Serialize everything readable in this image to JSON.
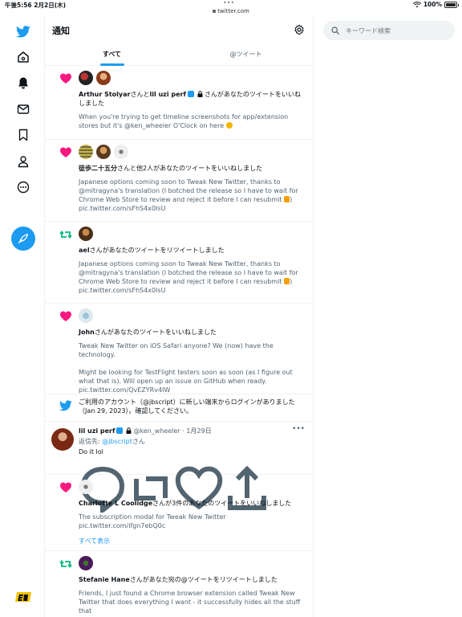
{
  "status": {
    "time": "午後5:56",
    "date": "2月2日(木)",
    "url": "twitter.com",
    "battery": "100%",
    "battery_level": 1.0
  },
  "header": {
    "title": "通知",
    "tabs": [
      "すべて",
      "@ツイート"
    ]
  },
  "search": {
    "placeholder": "キーワード検索"
  },
  "notifications": [
    {
      "kind": "like",
      "name1": "Arthur Stolyar",
      "mid": "さんと",
      "name2": "lil uzi perf",
      "rest": "さんがあなたのツイートをいいねしました",
      "snippet": "When you're trying to get timeline screenshots for app/extension stores but it's @ken_wheeler O'Clock on here"
    },
    {
      "kind": "like",
      "name1": "徒歩二十五分",
      "rest": "さんと他2人があなたのツイートをいいねしました",
      "snippet": "Japanese options coming soon to Tweak New Twitter, thanks to @mitragyna's translation (I botched the release so I have to wait for Chrome Web Store to review and reject it before I can resubmit",
      "link": "pic.twitter.com/sFhS4x0IsU"
    },
    {
      "kind": "retweet",
      "name1": "ael",
      "rest": "さんがあなたのツイートをリツイートしました",
      "snippet": "Japanese options coming soon to Tweak New Twitter, thanks to @mitragyna's translation (I botched the release so I have to wait for Chrome Web Store to review and reject it before I can resubmit",
      "link": "pic.twitter.com/sFhS4x0IsU"
    },
    {
      "kind": "like",
      "name1": "John",
      "rest": "さんがあなたのツイートをいいねしました",
      "snippet": "Tweak New Twitter on iOS Safari anyone? We (now) have the technology.",
      "snippet2": "Might be looking for TestFlight testers soon as soon (as I figure out what that is). Will open up an issue on GitHub when ready.",
      "link": "pic.twitter.com/QvEZYRv4IW"
    }
  ],
  "login_notice": "ご利用のアカウント（@jbscript）に新しい端末からログインがありました（Jan 29, 2023）。確認してください。",
  "tweet": {
    "name": "lil uzi perf",
    "handle": "@ken_wheeler",
    "sep": "·",
    "date": "1月29日",
    "reply_prefix": "返信先: ",
    "reply_to": "@jbscript",
    "reply_suffix": "さん",
    "text": "Do it lol"
  },
  "notif5": {
    "name1": "Charlotte L Coolidge",
    "rest": "さんが3件のあなたのツイートをいいねしました",
    "snippet": "The subscription modal for Tweak New Twitter",
    "link": "pic.twitter.com/ifgn7ebQ0c",
    "show_all": "すべて表示"
  },
  "notif6": {
    "name1": "Stefanie Hane",
    "rest": "さんがあなた宛の@ツイートをリツイートしました",
    "snippet": "Friends, I just found a Chrome browser extension called Tweak New Twitter that does everything I want - it successfully hides all the stuff that"
  },
  "colors": {
    "accent": "#1d9bf0",
    "like": "#f91880",
    "retweet": "#00ba7c"
  }
}
